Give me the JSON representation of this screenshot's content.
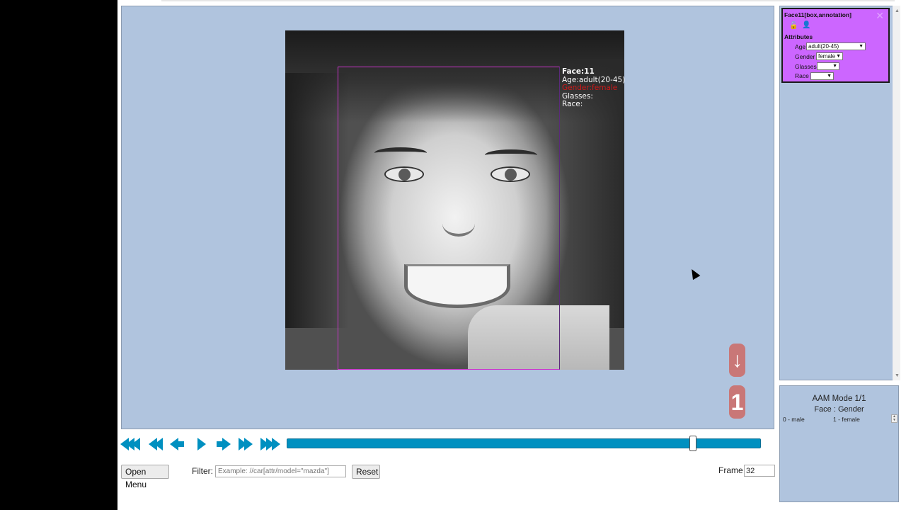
{
  "annotation": {
    "object_title": "Face:11",
    "age_line": "Age:adult(20-45)",
    "gender_line": "Gender:female",
    "glasses_line": "Glasses:",
    "race_line": "Race:"
  },
  "side_buttons": {
    "down_arrow": "↓",
    "number": "1"
  },
  "player": {
    "icons": [
      "fast-backward-icon",
      "step-backward-icon",
      "previous-frame-icon",
      "play-icon",
      "next-frame-icon",
      "step-forward-icon",
      "fast-forward-icon"
    ],
    "slider_value": 32
  },
  "bottom_bar": {
    "open_menu": "Open Menu",
    "filter_label": "Filter:",
    "filter_placeholder": "Example: //car[attr/model=\"mazda\"]",
    "reset": "Reset",
    "frame_label": "Frame",
    "frame_value": "32"
  },
  "object_card": {
    "title": "Face11[box,annotation]",
    "attributes_heading": "Attributes",
    "age_label": "Age",
    "age_value": "adult(20-45)",
    "gender_label": "Gender",
    "gender_value": "female",
    "glasses_label": "Glasses",
    "glasses_value": "",
    "race_label": "Race",
    "race_value": ""
  },
  "aam_panel": {
    "mode": "AAM Mode 1/1",
    "subtitle": "Face : Gender",
    "option_0": "0 - male",
    "option_1": "1 - female"
  },
  "colors": {
    "canvas": "#b0c4de",
    "accent": "#0090c0",
    "card": "#cc66ff",
    "box": "#cc33cc",
    "fab": "#c97777"
  }
}
